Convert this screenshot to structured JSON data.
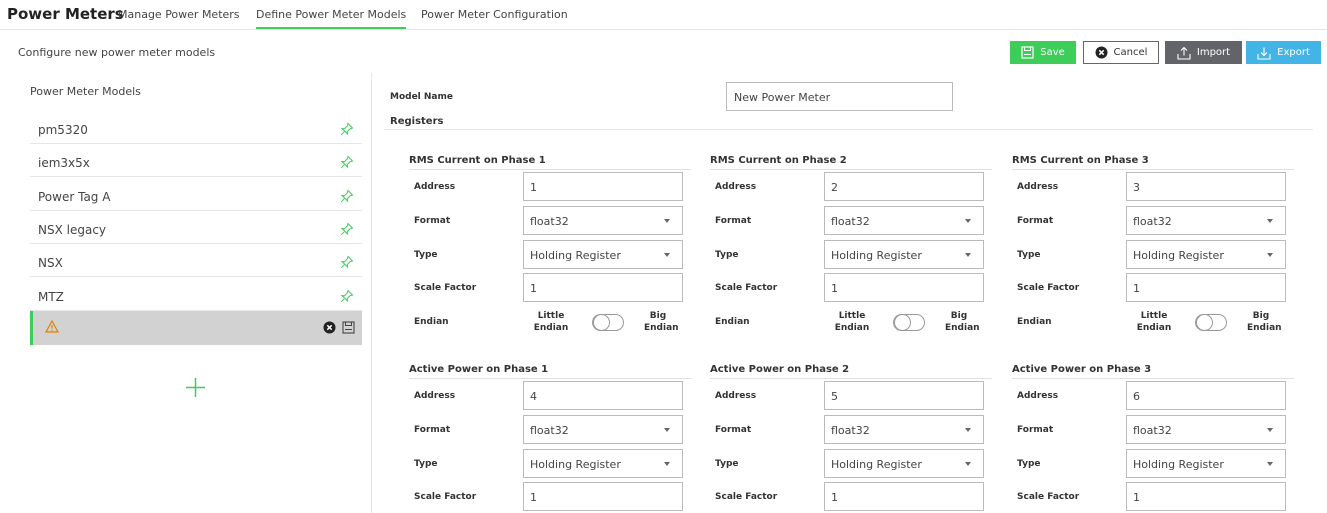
{
  "header": {
    "title": "Power Meters",
    "tabs": [
      {
        "label": "Manage Power Meters",
        "active": false
      },
      {
        "label": "Define Power Meter Models",
        "active": true
      },
      {
        "label": "Power Meter Configuration",
        "active": false
      }
    ]
  },
  "toolbar": {
    "subtitle": "Configure new power meter models",
    "save_label": "Save",
    "cancel_label": "Cancel",
    "import_label": "Import",
    "export_label": "Export"
  },
  "sidebar": {
    "title": "Power Meter Models",
    "models": [
      {
        "name": "pm5320"
      },
      {
        "name": "iem3x5x"
      },
      {
        "name": "Power Tag A"
      },
      {
        "name": "NSX legacy"
      },
      {
        "name": "NSX"
      },
      {
        "name": "MTZ"
      }
    ],
    "new_model_icon": "warning-icon"
  },
  "form": {
    "model_name_label": "Model Name",
    "model_name_value": "New Power Meter",
    "registers_label": "Registers"
  },
  "field_labels": {
    "address": "Address",
    "format": "Format",
    "type": "Type",
    "scale": "Scale Factor",
    "endian": "Endian",
    "little": "Little Endian",
    "big": "Big Endian"
  },
  "registers": [
    {
      "title": "RMS Current on Phase 1",
      "address": "1",
      "format": "float32",
      "type": "Holding Register",
      "scale": "1"
    },
    {
      "title": "RMS Current on Phase 2",
      "address": "2",
      "format": "float32",
      "type": "Holding Register",
      "scale": "1"
    },
    {
      "title": "RMS Current on Phase 3",
      "address": "3",
      "format": "float32",
      "type": "Holding Register",
      "scale": "1"
    },
    {
      "title": "Active Power on Phase 1",
      "address": "4",
      "format": "float32",
      "type": "Holding Register",
      "scale": "1"
    },
    {
      "title": "Active Power on Phase 2",
      "address": "5",
      "format": "float32",
      "type": "Holding Register",
      "scale": "1"
    },
    {
      "title": "Active Power on Phase 3",
      "address": "6",
      "format": "float32",
      "type": "Holding Register",
      "scale": "1"
    }
  ],
  "colors": {
    "accent_green": "#3dcd58",
    "import_gray": "#626469",
    "export_blue": "#42b4e6",
    "warning_orange": "#e47f00"
  }
}
